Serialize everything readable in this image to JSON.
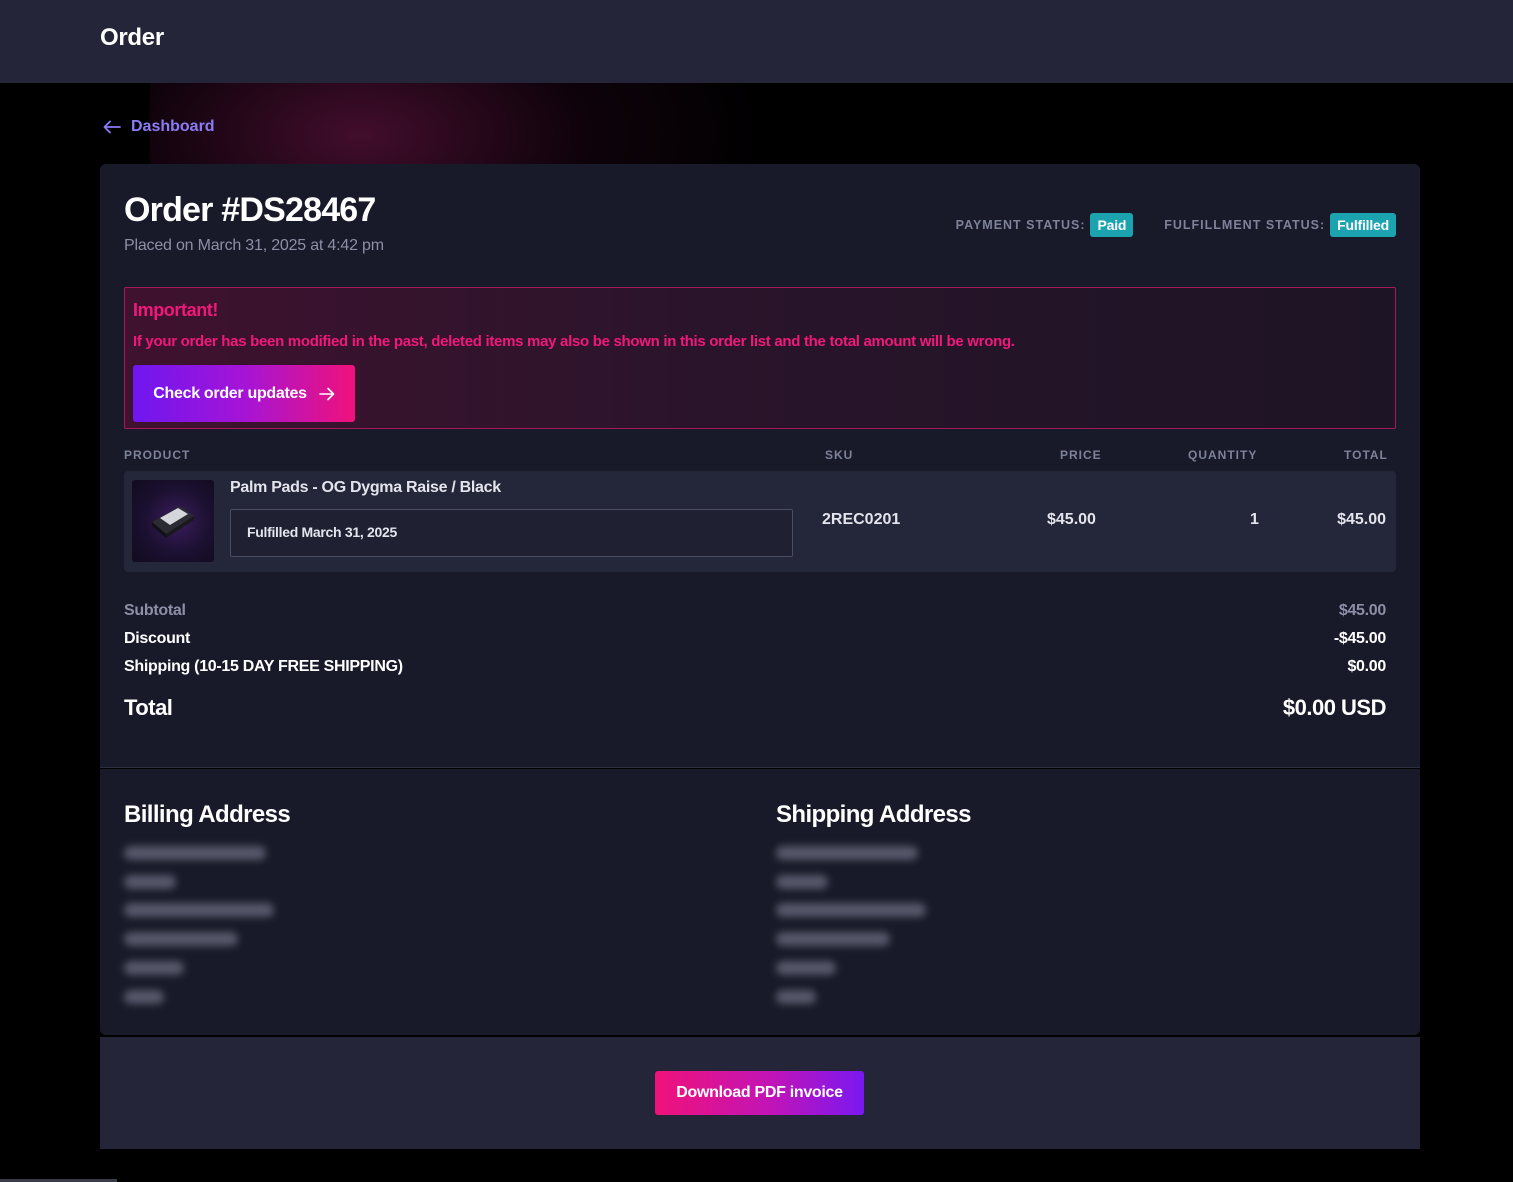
{
  "header": {
    "title": "Order"
  },
  "breadcrumb": {
    "back_label": "Dashboard"
  },
  "order": {
    "title": "Order #DS28467",
    "placed": "Placed on March 31, 2025 at 4:42 pm",
    "payment_status_label": "PAYMENT STATUS:",
    "payment_status": "Paid",
    "fulfillment_status_label": "FULFILLMENT STATUS:",
    "fulfillment_status": "Fulfilled"
  },
  "alert": {
    "title": "Important!",
    "text": "If your order has been modified in the past, deleted items may also be shown in this order list and the total amount will be wrong.",
    "button_label": "Check order updates"
  },
  "table": {
    "columns": [
      "PRODUCT",
      "SKU",
      "PRICE",
      "QUANTITY",
      "TOTAL"
    ],
    "rows": [
      {
        "product": "Palm Pads - OG Dygma Raise / Black",
        "fulfilled": "Fulfilled March 31, 2025",
        "sku": "2REC0201",
        "price": "$45.00",
        "quantity": "1",
        "total": "$45.00"
      }
    ]
  },
  "summary": {
    "subtotal_label": "Subtotal",
    "subtotal": "$45.00",
    "discount_label": "Discount",
    "discount": "-$45.00",
    "shipping_label": "Shipping (10-15 DAY FREE SHIPPING)",
    "shipping": "$0.00",
    "total_label": "Total",
    "total": "$0.00 USD"
  },
  "addresses": {
    "billing_title": "Billing Address",
    "shipping_title": "Shipping Address"
  },
  "footer": {
    "pdf_button_label": "Download PDF invoice"
  },
  "colors": {
    "accent_purple": "#8a7cf5",
    "alert_pink": "#f0197a",
    "badge_teal": "#1ba4b0",
    "card_bg": "#181a29",
    "row_bg": "#242639"
  }
}
